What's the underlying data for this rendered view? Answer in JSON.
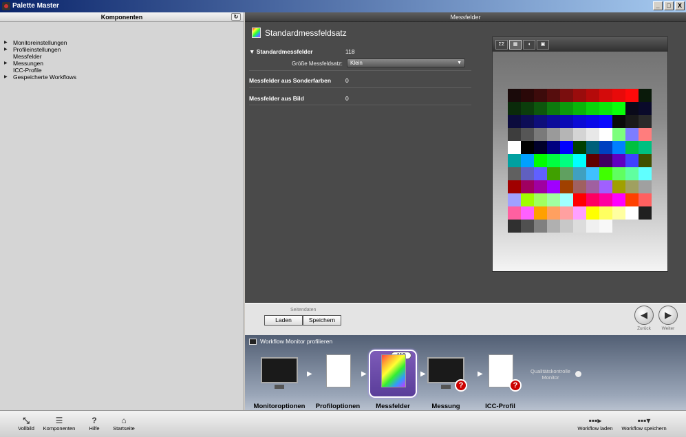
{
  "window": {
    "title": "Palette Master",
    "buttons": [
      "_",
      "□",
      "X"
    ]
  },
  "left_panel": {
    "header": "Komponenten",
    "tree": [
      {
        "label": "Monitoreinstellungen",
        "expandable": true
      },
      {
        "label": "Profileinstellungen",
        "expandable": true
      },
      {
        "label": "Messfelder",
        "expandable": false
      },
      {
        "label": "Messungen",
        "expandable": true
      },
      {
        "label": "ICC-Profile",
        "expandable": false
      },
      {
        "label": "Gespeicherte Workflows",
        "expandable": true
      }
    ]
  },
  "right_panel": {
    "header": "Messfelder",
    "page_title": "Standardmessfeldsatz",
    "sections": {
      "standard": {
        "label": "Standardmessfelder",
        "value": "118"
      },
      "size_label": "Größe Messfeldsatz:",
      "size_value": "Klein",
      "spot": {
        "label": "Messfelder aus Sonderfarben",
        "value": "0"
      },
      "image": {
        "label": "Messfelder aus Bild",
        "value": "0"
      }
    },
    "preview_toolbar": [
      "ΣΣ",
      "▦",
      "◖",
      "▣"
    ],
    "swatches": [
      "#1a0a0a",
      "#2a0808",
      "#3d0b0b",
      "#560d0d",
      "#7a0e0e",
      "#9a0c0c",
      "#b50a0a",
      "#d40b0b",
      "#e80a0a",
      "#ff0a0a",
      "#0a1a0a",
      "#0a2a0a",
      "#0b3d0b",
      "#0d560d",
      "#0e7a0e",
      "#0c9a0c",
      "#0ab50a",
      "#0bd40b",
      "#0ae80a",
      "#0aff0a",
      "#0a0a1a",
      "#0a0a2a",
      "#0b0b3d",
      "#0d0d56",
      "#0e0e7a",
      "#0c0c9a",
      "#0a0ab5",
      "#0b0bd4",
      "#0a0ae8",
      "#0a0aff",
      "#0a0a0a",
      "#1a1a1a",
      "#2a2a2a",
      "#3d3d3d",
      "#565656",
      "#7a7a7a",
      "#9a9a9a",
      "#b5b5b5",
      "#d4d4d4",
      "#e8e8e8",
      "#ffffff",
      "#7dff7d",
      "#7d7dff",
      "#ff7d7d",
      "#ffffff",
      "#000000",
      "#00002a",
      "#000080",
      "#0000ff",
      "#004000",
      "#00607a",
      "#0040c0",
      "#0080ff",
      "#00c040",
      "#00c080",
      "#00a0a0",
      "#00a0ff",
      "#00ff00",
      "#00ff40",
      "#00ff80",
      "#00ffff",
      "#600000",
      "#400060",
      "#6000c0",
      "#4040ff",
      "#405000",
      "#606060",
      "#6060c0",
      "#6060ff",
      "#40a000",
      "#60a060",
      "#40a0c0",
      "#40c0ff",
      "#40ff00",
      "#60ff60",
      "#60ffa0",
      "#60ffff",
      "#a00000",
      "#a00060",
      "#a000a0",
      "#a000ff",
      "#a04000",
      "#a06060",
      "#a060a0",
      "#a060ff",
      "#a0a000",
      "#a0a060",
      "#a0a0a0",
      "#a0a0ff",
      "#a0ff00",
      "#a0ff60",
      "#a0ffa0",
      "#a0ffff",
      "#ff0000",
      "#ff0060",
      "#ff00a0",
      "#ff00ff",
      "#ff4000",
      "#ff6060",
      "#ff60a0",
      "#ff60ff",
      "#ffa000",
      "#ffa060",
      "#ffa0a0",
      "#ffa0ff",
      "#ffff00",
      "#ffff60",
      "#ffffa0",
      "#ffffff",
      "#202020",
      "#303030",
      "#505050",
      "#808080",
      "#b0b0b0",
      "#c8c8c8",
      "#dcdcdc",
      "#f0f0f0",
      "#f8f8f8"
    ]
  },
  "page_data_bar": {
    "caption": "Seitendaten",
    "load": "Laden",
    "save": "Speichern",
    "back": "Zurück",
    "next": "Weiter"
  },
  "workflow": {
    "title": "Workflow Monitor profilieren",
    "steps": [
      {
        "label": "Monitoroptionen"
      },
      {
        "label": "Profiloptionen"
      },
      {
        "label": "Messfelder",
        "badge": "118"
      },
      {
        "label": "Messung"
      },
      {
        "label": "ICC-Profil"
      }
    ],
    "quality": "Qualitätskontrolle Monitor"
  },
  "bottom_toolbar": {
    "left": [
      {
        "label": "Vollbild",
        "icon": "fullscreen-icon"
      },
      {
        "label": "Komponenten",
        "icon": "list-icon"
      },
      {
        "label": "Hilfe",
        "icon": "help-icon"
      },
      {
        "label": "Startseite",
        "icon": "home-icon"
      }
    ],
    "right": [
      {
        "label": "Workflow laden",
        "icon": "workflow-load-icon"
      },
      {
        "label": "Workflow speichern",
        "icon": "workflow-save-icon"
      }
    ]
  }
}
